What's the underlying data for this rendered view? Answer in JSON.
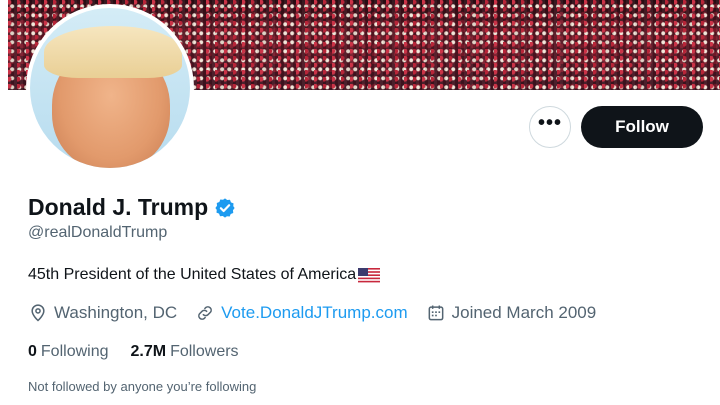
{
  "profile": {
    "display_name": "Donald J. Trump",
    "handle": "@realDonaldTrump",
    "bio": "45th President of the United States of America",
    "location": "Washington, DC",
    "website": "Vote.DonaldJTrump.com",
    "joined": "Joined March 2009"
  },
  "actions": {
    "more_label": "•••",
    "follow_label": "Follow"
  },
  "stats": {
    "following_count": "0",
    "following_label": "Following",
    "followers_count": "2.7M",
    "followers_label": "Followers"
  },
  "followed_note": "Not followed by anyone you’re following",
  "colors": {
    "accent": "#1d9bf0",
    "follow_button": "#0f1419",
    "secondary_text": "#536471"
  },
  "icons": [
    "location-icon",
    "link-icon",
    "calendar-icon",
    "verified-badge-icon",
    "us-flag-icon"
  ]
}
